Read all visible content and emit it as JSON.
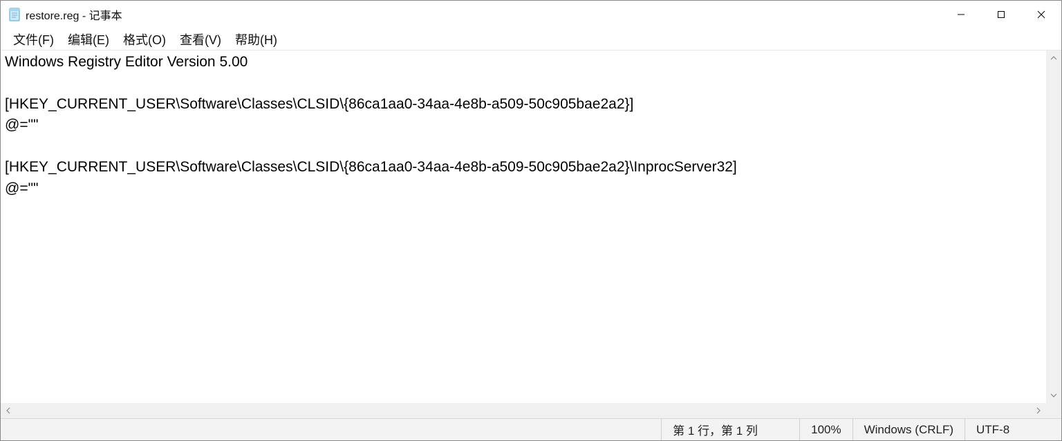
{
  "title": "restore.reg - 记事本",
  "menu": {
    "file": "文件(F)",
    "edit": "编辑(E)",
    "format": "格式(O)",
    "view": "查看(V)",
    "help": "帮助(H)"
  },
  "content": "Windows Registry Editor Version 5.00\n\n[HKEY_CURRENT_USER\\Software\\Classes\\CLSID\\{86ca1aa0-34aa-4e8b-a509-50c905bae2a2}]\n@=\"\"\n\n[HKEY_CURRENT_USER\\Software\\Classes\\CLSID\\{86ca1aa0-34aa-4e8b-a509-50c905bae2a2}\\InprocServer32]\n@=\"\"",
  "status": {
    "position": "第 1 行，第 1 列",
    "zoom": "100%",
    "line_ending": "Windows (CRLF)",
    "encoding": "UTF-8"
  }
}
